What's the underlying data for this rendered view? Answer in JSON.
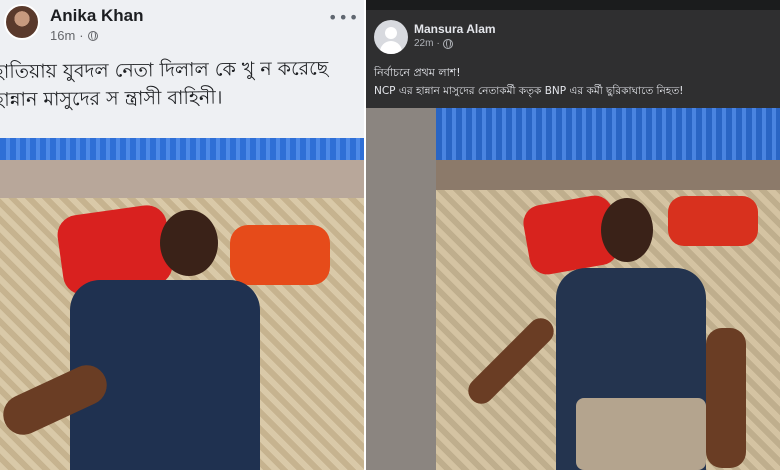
{
  "left_post": {
    "author": "Anika Khan",
    "time": "16m",
    "privacy_icon": "globe-icon",
    "more_icon": "more-options-icon",
    "more_label": "•••",
    "text_line1": "হাতিয়ায় যুবদল নেতা দিলাল কে খু ন করেছে",
    "text_line2": "হান্নান মাসুদের স ন্ত্রাসী বাহিনী।",
    "theme": "light"
  },
  "right_post": {
    "author": "Mansura Alam",
    "time": "22m",
    "privacy_icon": "globe-icon",
    "text_line1": "নির্বাচনে প্রথম লাশ!",
    "text_line2": "NCP এর হান্নান মাসুদের নেতাকর্মী কতৃক BNP এর কর্মী ছুরিকাঘাতে নিহত!",
    "theme": "dark"
  }
}
